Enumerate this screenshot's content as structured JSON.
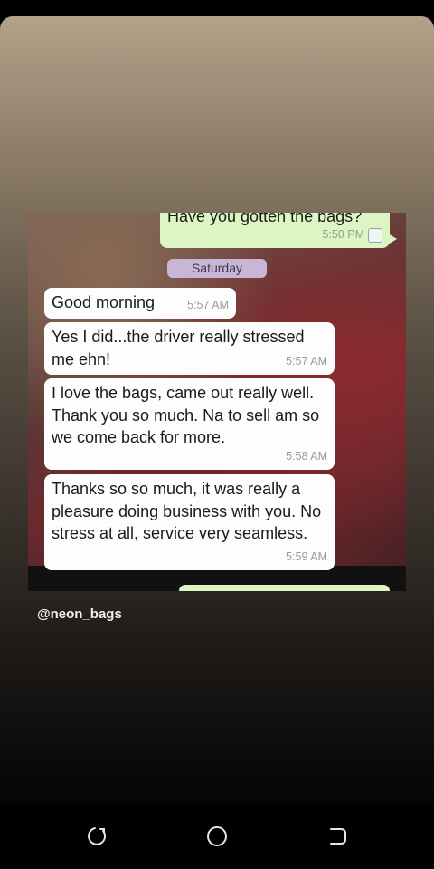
{
  "story": {
    "handle": "@neon_bags"
  },
  "chat": {
    "date_separator": "Saturday",
    "messages": [
      {
        "direction": "outgoing",
        "text": "Have you gotten the bags?",
        "time": "5:50 PM"
      },
      {
        "direction": "incoming",
        "text": "Good morning",
        "time": "5:57 AM"
      },
      {
        "direction": "incoming",
        "text": "Yes I did...the driver really stressed me ehn!",
        "time": "5:57 AM"
      },
      {
        "direction": "incoming",
        "text": "I love the bags, came out really well. Thank you so much. Na to sell am so we come back for more.",
        "time": "5:58 AM"
      },
      {
        "direction": "incoming",
        "text": "Thanks so so much, it was really a pleasure doing business with you. No stress at all, service very seamless.",
        "time": "5:59 AM"
      }
    ]
  },
  "navbar": {
    "icons": [
      "recent-apps-icon",
      "home-icon",
      "back-icon"
    ]
  }
}
